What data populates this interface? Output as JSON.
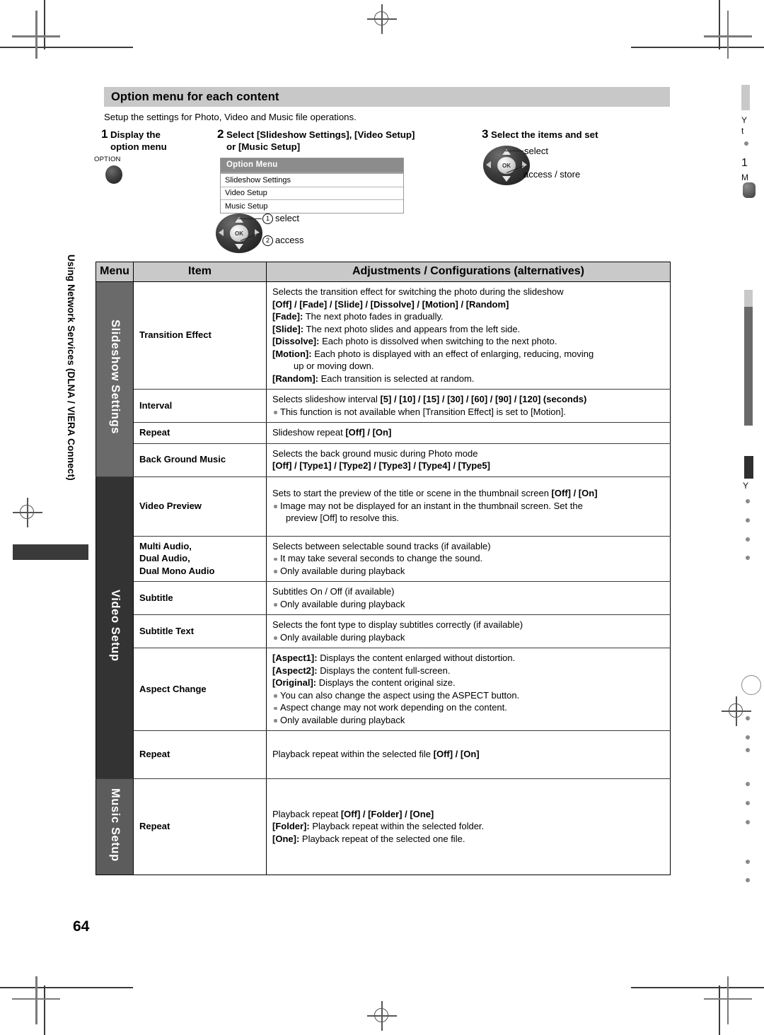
{
  "document": {
    "page_number": "64",
    "side_tab_label": "Using Network Services (DLNA / VIERA Connect)"
  },
  "section": {
    "heading": "Option menu for each content",
    "intro": "Setup the settings for Photo, Video and Music file operations."
  },
  "steps": [
    {
      "num": "1",
      "text": "Display the\noption menu",
      "button_label": "OPTION"
    },
    {
      "num": "2",
      "text": "Select [Slideshow Settings], [Video Setup]\n or [Music Setup]"
    },
    {
      "num": "3",
      "text": "Select the items and set"
    }
  ],
  "tv_menu": {
    "title": "Option Menu",
    "items": [
      "Slideshow Settings",
      "Video Setup",
      "Music Setup"
    ]
  },
  "dpad_step2": {
    "ok_label": "OK",
    "callout_select": "select",
    "callout_access": "access",
    "marker_select": "1",
    "marker_access": "2"
  },
  "dpad_step3": {
    "ok_label": "OK",
    "callout_select": "select",
    "callout_access": "access / store"
  },
  "table": {
    "headers": {
      "menu": "Menu",
      "item": "Item",
      "adjustments": "Adjustments / Configurations (alternatives)"
    },
    "groups": [
      {
        "menu": "Slideshow Settings",
        "rows": [
          {
            "item": "Transition Effect",
            "lines": [
              {
                "type": "plain",
                "text": "Selects the transition effect for switching the photo during the slideshow"
              },
              {
                "type": "bold",
                "text": "[Off] / [Fade] / [Slide] / [Dissolve] / [Motion] / [Random]"
              },
              {
                "type": "lead",
                "lead": "[Fade]:",
                "text": " The next photo fades in gradually."
              },
              {
                "type": "lead",
                "lead": "[Slide]:",
                "text": " The next photo slides and appears from the left side."
              },
              {
                "type": "lead",
                "lead": "[Dissolve]:",
                "text": " Each photo is dissolved when switching to the next photo."
              },
              {
                "type": "lead",
                "lead": "[Motion]:",
                "text": " Each photo is displayed with an effect of enlarging, reducing, moving"
              },
              {
                "type": "indent",
                "text": "up or moving down."
              },
              {
                "type": "lead",
                "lead": "[Random]:",
                "text": " Each transition is selected at random."
              }
            ]
          },
          {
            "item": "Interval",
            "lines": [
              {
                "type": "mixed",
                "text": "Selects slideshow interval ",
                "bold": "[5] / [10] / [15] / [30] / [60] / [90] / [120] (seconds)"
              },
              {
                "type": "bullet",
                "text": "This function is not available when [Transition Effect] is set to [Motion]."
              }
            ]
          },
          {
            "item": "Repeat",
            "lines": [
              {
                "type": "mixed",
                "text": "Slideshow repeat ",
                "bold": "[Off] / [On]"
              }
            ]
          },
          {
            "item": "Back Ground Music",
            "lines": [
              {
                "type": "plain",
                "text": "Selects the back ground music during Photo mode"
              },
              {
                "type": "bold",
                "text": "[Off] / [Type1] / [Type2] / [Type3] / [Type4] / [Type5]"
              }
            ]
          }
        ]
      },
      {
        "menu": "Video Setup",
        "rows": [
          {
            "item": "Video Preview",
            "lines": [
              {
                "type": "mixed",
                "text": "Sets to start the preview of the title or scene in the thumbnail screen ",
                "bold": "[Off] / [On]"
              },
              {
                "type": "bullet",
                "text": "Image may not be displayed for an instant in the thumbnail screen. Set the"
              },
              {
                "type": "indent2",
                "text": "preview [Off] to resolve this."
              }
            ]
          },
          {
            "item": "Multi Audio,\nDual Audio,\nDual Mono Audio",
            "lines": [
              {
                "type": "plain",
                "text": "Selects between selectable sound tracks (if available)"
              },
              {
                "type": "bullet",
                "text": "It may take several seconds to change the sound."
              },
              {
                "type": "bullet",
                "text": "Only available during playback"
              }
            ]
          },
          {
            "item": "Subtitle",
            "lines": [
              {
                "type": "plain",
                "text": "Subtitles On / Off (if available)"
              },
              {
                "type": "bullet",
                "text": "Only available during playback"
              }
            ]
          },
          {
            "item": "Subtitle Text",
            "lines": [
              {
                "type": "plain",
                "text": "Selects the font type to display subtitles correctly (if available)"
              },
              {
                "type": "bullet",
                "text": "Only available during playback"
              }
            ]
          },
          {
            "item": "Aspect Change",
            "lines": [
              {
                "type": "lead",
                "lead": "[Aspect1]:",
                "text": " Displays the content enlarged without distortion."
              },
              {
                "type": "lead",
                "lead": "[Aspect2]:",
                "text": " Displays the content full-screen."
              },
              {
                "type": "lead",
                "lead": "[Original]:",
                "text": " Displays the content original size."
              },
              {
                "type": "bullet",
                "text": "You can also change the aspect using the ASPECT button."
              },
              {
                "type": "bullet",
                "text": "Aspect change may not work depending on the content."
              },
              {
                "type": "bullet",
                "text": "Only available during playback"
              }
            ]
          },
          {
            "item": "Repeat",
            "lines": [
              {
                "type": "mixed",
                "text": "Playback repeat within the selected file ",
                "bold": "[Off] / [On]"
              }
            ]
          }
        ]
      },
      {
        "menu": "Music Setup",
        "rows": [
          {
            "item": "Repeat",
            "lines": [
              {
                "type": "mixed",
                "text": "Playback repeat ",
                "bold": "[Off] / [Folder] / [One]"
              },
              {
                "type": "lead",
                "lead": "[Folder]:",
                "text": " Playback repeat within the selected folder."
              },
              {
                "type": "lead",
                "lead": "[One]:",
                "text": " Playback repeat of the selected one file."
              }
            ]
          }
        ]
      }
    ]
  },
  "bleed": {
    "fragments": [
      "Y",
      "t",
      "1",
      "M",
      "Y"
    ]
  },
  "colors": {
    "heading_bar": "#c8c8c8",
    "table_header": "#c9c9c9",
    "menu_group_1": "#6a6a6a",
    "menu_group_2": "#333333",
    "menu_group_3": "#5c5c5c",
    "tv_menu_header": "#8c8c8c"
  }
}
